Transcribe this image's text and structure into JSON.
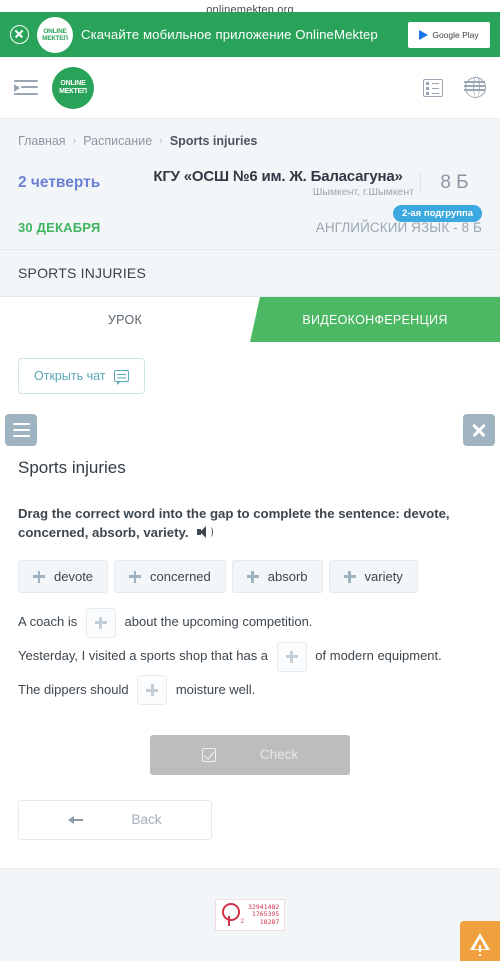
{
  "browser": {
    "url": "onlinemektep.org"
  },
  "app_banner": {
    "close_label": "×",
    "logo_line1": "ONLINE",
    "logo_line2": "МЕКТЕП",
    "text": "Скачайте мобильное приложение OnlineMektep",
    "store_button": "Google Play",
    "bg_color": "#2aa35a"
  },
  "navbar": {
    "logo_line1": "ONLINE",
    "logo_line2": "МЕКТЕП",
    "icons": [
      "list-icon",
      "globe-icon"
    ]
  },
  "breadcrumb": {
    "items": [
      {
        "label": "Главная",
        "current": false
      },
      {
        "label": "Расписание",
        "current": false
      },
      {
        "label": "Sports injuries",
        "current": true
      }
    ],
    "separator": "›"
  },
  "header": {
    "quarter": "2 четверть",
    "school_name": "КГУ «ОСШ №6 им. Ж. Баласагуна»",
    "school_city": "Шымкент, г.Шымкент",
    "grade": "8 Б",
    "date": "30 ДЕКАБРЯ",
    "subject": "АНГЛИЙСКИЙ ЯЗЫК - 8 Б",
    "subgroup_badge": "2-ая подгруппа",
    "badge_color": "#3ba8e0",
    "date_color": "#3fb55e",
    "quarter_color": "#6b7fd7"
  },
  "lesson": {
    "title": "SPORTS INJURIES"
  },
  "tabs": [
    {
      "label": "УРОК",
      "active": false
    },
    {
      "label": "ВИДЕОКОНФЕРЕНЦИЯ",
      "active": true
    }
  ],
  "chat": {
    "button_label": "Открыть чат"
  },
  "exercise": {
    "title": "Sports injuries",
    "instruction": "Drag the correct word into the gap to complete the sentence: devote, concerned, absorb, variety.",
    "word_chips": [
      "devote",
      "concerned",
      "absorb",
      "variety"
    ],
    "sentences": [
      {
        "before": "A coach is",
        "after": "about the upcoming competition."
      },
      {
        "before": "Yesterday, I visited a sports shop that has a",
        "after": "of modern equipment."
      },
      {
        "before": "The dippers should",
        "after": "moisture well."
      }
    ],
    "check_label": "Check",
    "back_label": "Back",
    "check_enabled": false
  },
  "footer": {
    "counter": {
      "sub": "2",
      "line1": "32941482",
      "line2": "1765395",
      "line3": "18287"
    },
    "warning_icon": "warning-triangle-icon"
  }
}
